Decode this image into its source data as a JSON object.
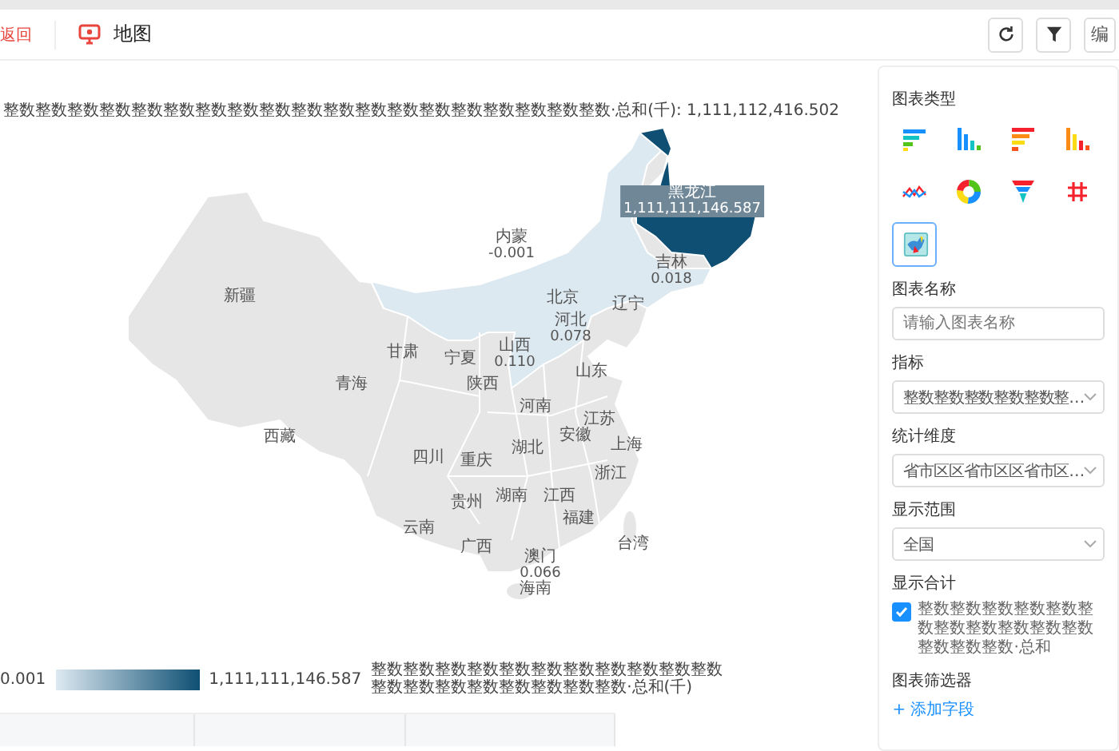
{
  "header": {
    "back": "返回",
    "title": "地图",
    "edit": "编"
  },
  "chart": {
    "title": "整数整数整数整数整数整数整数整数整数整数整数整数整数整数整数整数整数整数整数·总和(千): 1,111,112,416.502",
    "regions": [
      {
        "name": "黑龙江",
        "value": "1,111,111,146.587",
        "kind": "max"
      },
      {
        "name": "内蒙",
        "value": "-0.001",
        "kind": "low"
      },
      {
        "name": "吉林",
        "value": "0.018",
        "kind": "low"
      },
      {
        "name": "辽宁",
        "kind": "none"
      },
      {
        "name": "北京",
        "kind": "none"
      },
      {
        "name": "河北",
        "value": "0.078",
        "kind": "low"
      },
      {
        "name": "山西",
        "value": "0.110",
        "kind": "low"
      },
      {
        "name": "新疆",
        "kind": "none"
      },
      {
        "name": "甘肃",
        "kind": "none"
      },
      {
        "name": "宁夏",
        "kind": "none"
      },
      {
        "name": "青海",
        "kind": "none"
      },
      {
        "name": "陕西",
        "kind": "none"
      },
      {
        "name": "山东",
        "kind": "none"
      },
      {
        "name": "河南",
        "kind": "none"
      },
      {
        "name": "江苏",
        "kind": "none"
      },
      {
        "name": "安徽",
        "kind": "none"
      },
      {
        "name": "上海",
        "kind": "none"
      },
      {
        "name": "西藏",
        "kind": "none"
      },
      {
        "name": "四川",
        "kind": "none"
      },
      {
        "name": "重庆",
        "kind": "none"
      },
      {
        "name": "湖北",
        "kind": "none"
      },
      {
        "name": "浙江",
        "kind": "none"
      },
      {
        "name": "贵州",
        "kind": "none"
      },
      {
        "name": "湖南",
        "kind": "none"
      },
      {
        "name": "江西",
        "kind": "none"
      },
      {
        "name": "福建",
        "kind": "none"
      },
      {
        "name": "云南",
        "kind": "none"
      },
      {
        "name": "广西",
        "kind": "none"
      },
      {
        "name": "台湾",
        "kind": "none"
      },
      {
        "name": "澳门",
        "value": "0.066",
        "kind": "low"
      },
      {
        "name": "海南",
        "kind": "none"
      }
    ],
    "legend": {
      "min": "0.001",
      "max": "1,111,111,146.587",
      "label": "整数整数整数整数整数整数整数整数整数整数整数整数整数整数整数整数整数整数整数·总和(千)"
    }
  },
  "panel": {
    "chart_type_label": "图表类型",
    "chart_types": [
      {
        "kind": "hbar",
        "selected": false
      },
      {
        "kind": "vbar",
        "selected": false
      },
      {
        "kind": "hbar-stacked",
        "selected": false
      },
      {
        "kind": "vbar-stacked",
        "selected": false
      },
      {
        "kind": "line",
        "selected": false
      },
      {
        "kind": "donut",
        "selected": false
      },
      {
        "kind": "funnel",
        "selected": false
      },
      {
        "kind": "table",
        "selected": false
      },
      {
        "kind": "map",
        "selected": true
      }
    ],
    "name_label": "图表名称",
    "name_placeholder": "请输入图表名称",
    "selects": [
      {
        "label": "指标",
        "value": "整数整数整数整数整数整…"
      },
      {
        "label": "统计维度",
        "value": "省市区区省市区区省市区…"
      },
      {
        "label": "显示范围",
        "value": "全国"
      }
    ],
    "total_label": "显示合计",
    "total_checked": true,
    "total_text": "整数整数整数整数整数整数整数整数整数整数整数整数整数整数·总和",
    "filter_label": "图表筛选器",
    "add_field": "+ 添加字段"
  }
}
